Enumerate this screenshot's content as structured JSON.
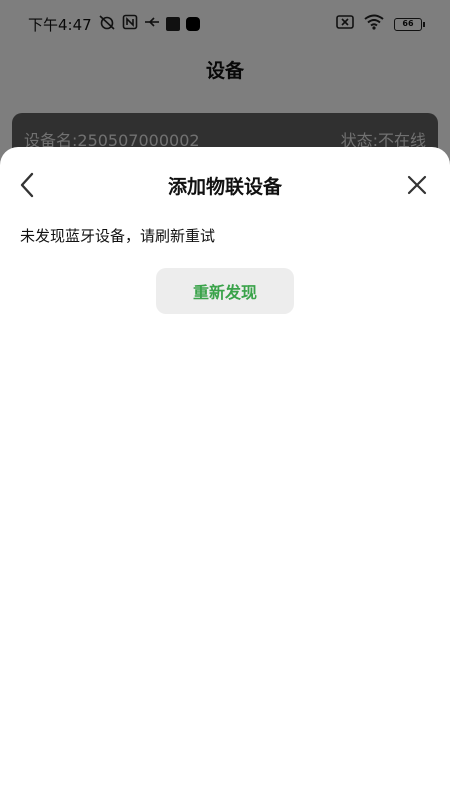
{
  "status_bar": {
    "time": "下午4:47",
    "battery": "66"
  },
  "page": {
    "title": "设备"
  },
  "device_card": {
    "name": "设备名:250507000002",
    "status": "状态:不在线"
  },
  "sheet": {
    "title": "添加物联设备",
    "message": "未发现蓝牙设备，请刷新重试",
    "retry_label": "重新发现"
  },
  "colors": {
    "accent": "#3aa34a",
    "button_bg": "#ededed"
  },
  "icons": [
    "back-icon",
    "close-icon",
    "wifi-icon",
    "battery-icon",
    "nfc-icon",
    "usb-icon",
    "alarm-off-icon"
  ]
}
